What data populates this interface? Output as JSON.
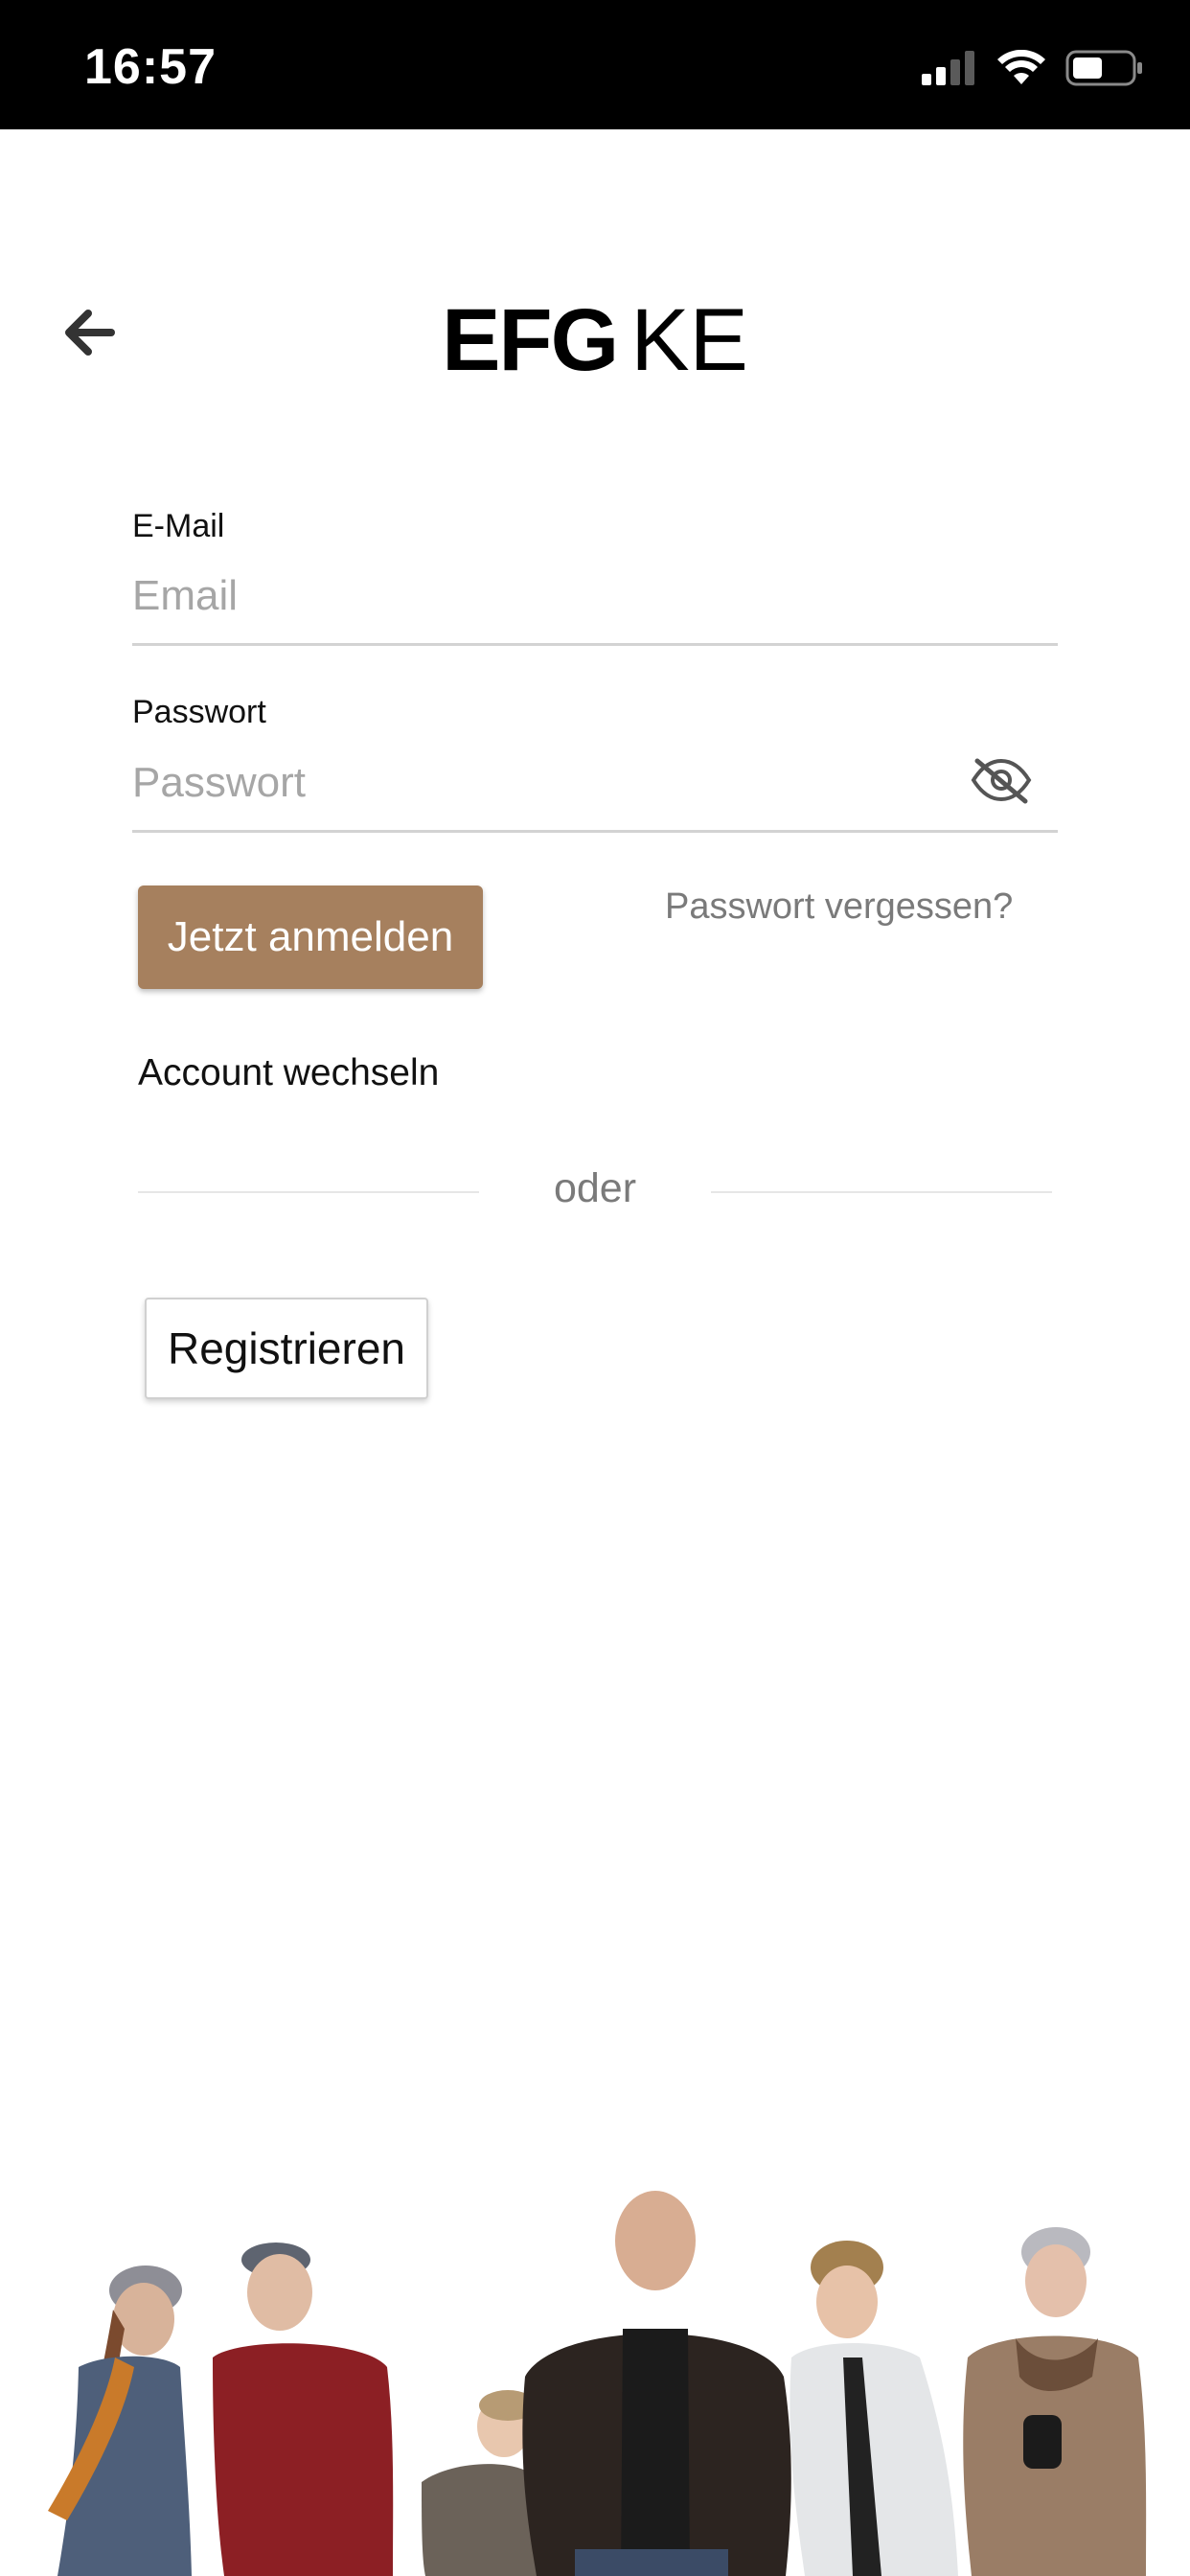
{
  "status_bar": {
    "time": "16:57",
    "icons": [
      "signal-icon",
      "wifi-icon",
      "battery-icon"
    ]
  },
  "header": {
    "back_icon": "arrow-left-icon",
    "logo_bold": "EFG",
    "logo_thin": "KE"
  },
  "form": {
    "email": {
      "label": "E-Mail",
      "placeholder": "Email",
      "value": ""
    },
    "password": {
      "label": "Passwort",
      "placeholder": "Passwort",
      "value": "",
      "toggle_icon": "eye-slash-icon"
    },
    "login_label": "Jetzt anmelden",
    "forgot_label": "Passwort vergessen?",
    "switch_account_label": "Account wechseln",
    "divider_label": "oder",
    "register_label": "Registrieren"
  },
  "colors": {
    "accent": "#a6805e",
    "status_bar": "#000000",
    "background": "#ffffff",
    "muted_text": "#7a7a7a",
    "placeholder": "#a6a6a6"
  },
  "footer": {
    "illustration": "group-of-people-photo"
  }
}
